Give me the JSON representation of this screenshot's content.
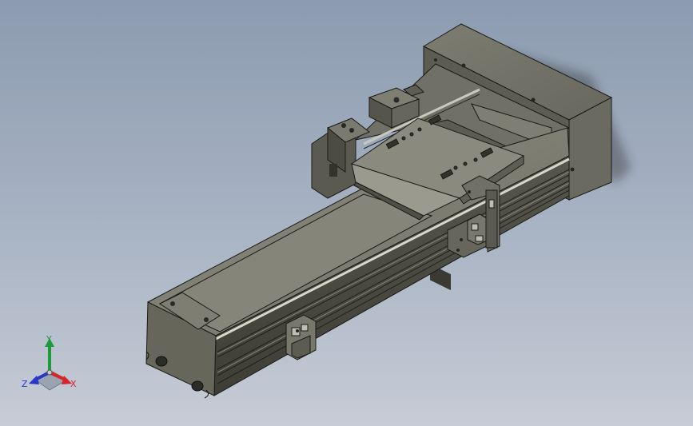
{
  "viewport": {
    "background_top": "#8c9bb0",
    "background_bottom": "#c7ccd6",
    "model_fill_dark": "#4d4d43",
    "model_fill_mid": "#6f6f64",
    "model_fill_light": "#8c8c80",
    "edge_color": "#1a1a16"
  },
  "triad": {
    "x_label": "X",
    "y_label": "Y",
    "z_label": "Z",
    "x_color": "#d8252a",
    "y_color": "#1d9a3a",
    "z_color": "#2636c9",
    "icons": [
      "triad-x-arrow-icon",
      "triad-y-arrow-icon",
      "triad-z-arrow-icon"
    ]
  }
}
